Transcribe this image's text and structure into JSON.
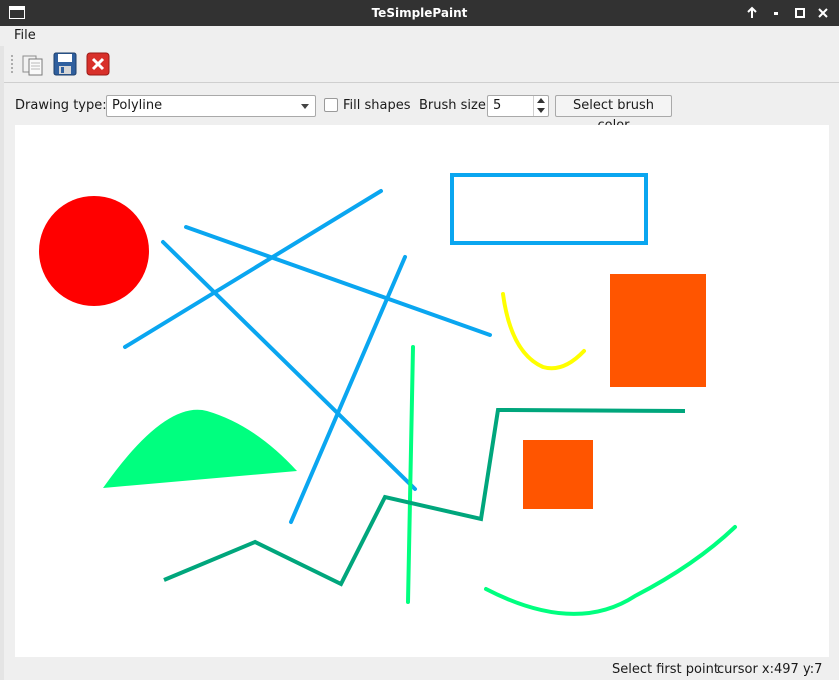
{
  "window": {
    "title": "TeSimplePaint"
  },
  "menu": {
    "file_label": "File"
  },
  "toolbar": {
    "icons": [
      "open-icon",
      "save-icon",
      "close-icon"
    ]
  },
  "options": {
    "drawing_type_label": "Drawing type:",
    "drawing_type_value": "Polyline",
    "fill_shapes_label": "Fill shapes",
    "fill_shapes_checked": false,
    "brush_size_label": "Brush size",
    "brush_size_value": "5",
    "select_color_label": "Select brush color"
  },
  "status": {
    "message": "Select first point",
    "cursor": "cursor x:497 y:7"
  },
  "colors": {
    "blue": "#0aa6f0",
    "red": "#ff0000",
    "orange": "#ff5500",
    "yellow": "#ffff00",
    "green_bright": "#00ff7f",
    "green_teal": "#00a67c"
  }
}
